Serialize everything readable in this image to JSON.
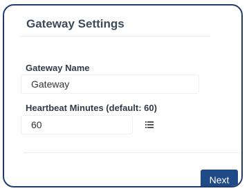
{
  "panel": {
    "title": "Gateway Settings"
  },
  "gateway_name": {
    "label": "Gateway Name",
    "value": "Gateway"
  },
  "heartbeat": {
    "label": "Heartbeat Minutes (default: 60)",
    "value": "60",
    "icon": "list-icon"
  },
  "actions": {
    "next_label": "Next"
  },
  "colors": {
    "border": "#1f3b6e",
    "button": "#1f4a85",
    "button_text": "#ffffff",
    "title": "#3b4a5a",
    "label": "#2f3b48"
  }
}
